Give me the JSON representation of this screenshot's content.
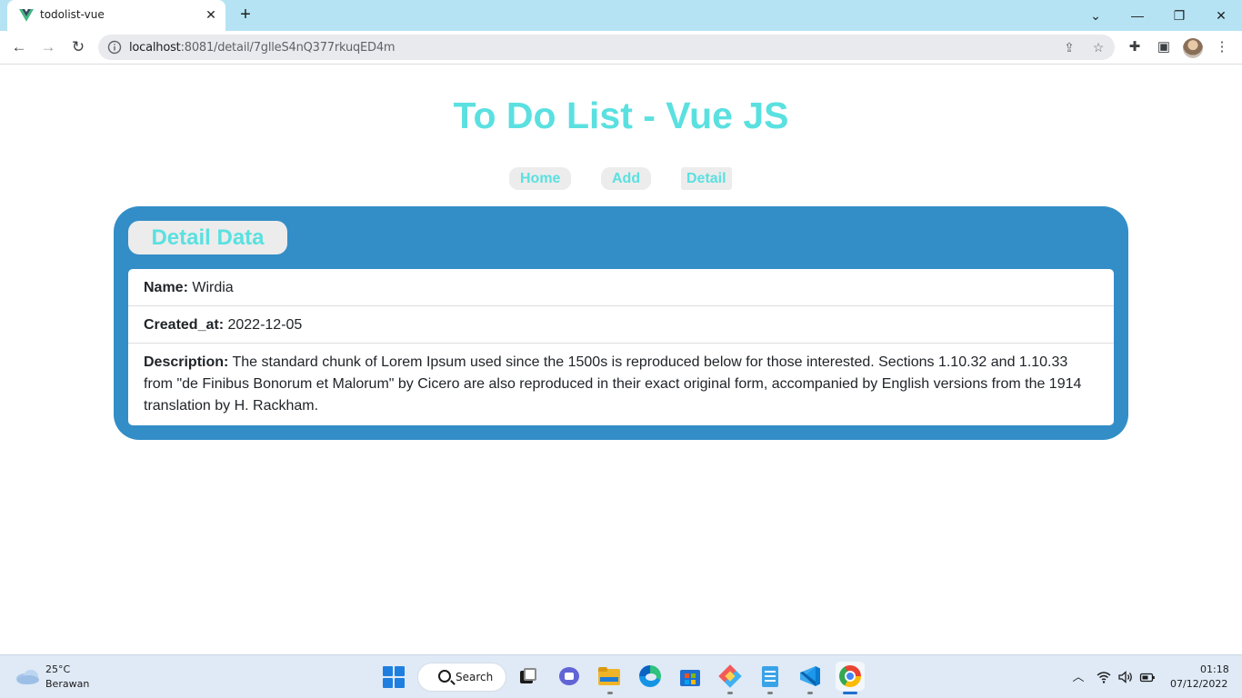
{
  "browser": {
    "tab_title": "todolist-vue",
    "new_tab": "+",
    "url_host": "localhost",
    "url_rest": ":8081/detail/7glleS4nQ377rkuqED4m"
  },
  "page": {
    "title": "To Do List - Vue JS",
    "nav": [
      "Home",
      "Add",
      "Detail"
    ],
    "card_title": "Detail Data",
    "fields": [
      {
        "label": "Name:",
        "value": "Wirdia"
      },
      {
        "label": "Created_at:",
        "value": "2022-12-05"
      },
      {
        "label": "Description:",
        "value": "The standard chunk of Lorem Ipsum used since the 1500s is reproduced below for those interested. Sections 1.10.32 and 1.10.33 from \"de Finibus Bonorum et Malorum\" by Cicero are also reproduced in their exact original form, accompanied by English versions from the 1914 translation by H. Rackham."
      }
    ]
  },
  "taskbar": {
    "weather_temp": "25°C",
    "weather_cond": "Berawan",
    "search_label": "Search",
    "time": "01:18",
    "date": "07/12/2022"
  },
  "colors": {
    "accent": "#5be0e0",
    "card": "#338ec7",
    "tabbar": "#b5e3f3"
  },
  "icons": [
    "vue-favicon",
    "close-icon",
    "back-icon",
    "forward-icon",
    "reload-icon",
    "info-icon",
    "share-icon",
    "star-icon",
    "extensions-icon",
    "sidepanel-icon",
    "menu-icon",
    "windows-start-icon",
    "search-icon",
    "wifi-icon",
    "volume-icon",
    "battery-icon"
  ]
}
